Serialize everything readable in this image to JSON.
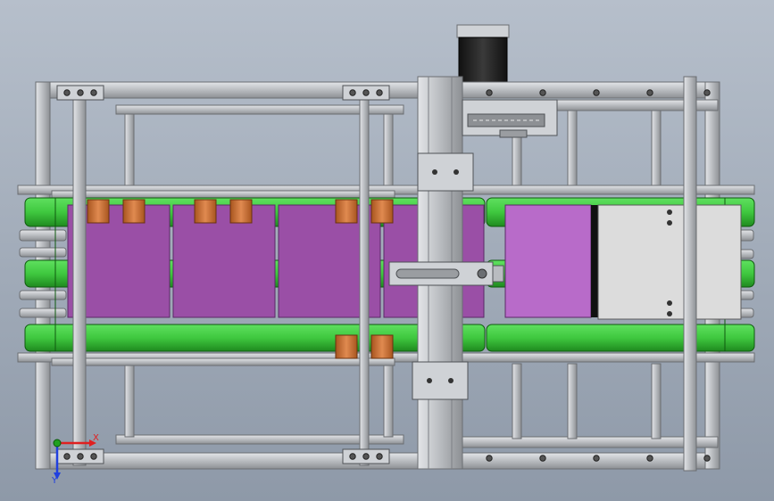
{
  "view": {
    "background_top": "#b6bfcb",
    "background_bottom": "#8e99a8"
  },
  "colors": {
    "frame": "#b9bcc0",
    "frame_dark": "#8d9094",
    "frame_light": "#d9dbde",
    "shaft": "#c3c6ca",
    "belt": "#3fc83f",
    "belt_dark": "#1f8a1f",
    "product": "#9a4fa6",
    "product_light": "#b86bc9",
    "roller": "#c8703a",
    "plate": "#dcdcdc",
    "motor": "#2b2b2b",
    "axis_x": "#e02020",
    "axis_y": "#2040e0",
    "axis_origin": "#20a020"
  },
  "icons": {
    "triad": "coordinate-triad-icon",
    "bolt": "bolt-hole-icon",
    "motor": "stepper-motor-icon"
  },
  "axes": {
    "x_label": "X",
    "y_label": "Y"
  }
}
